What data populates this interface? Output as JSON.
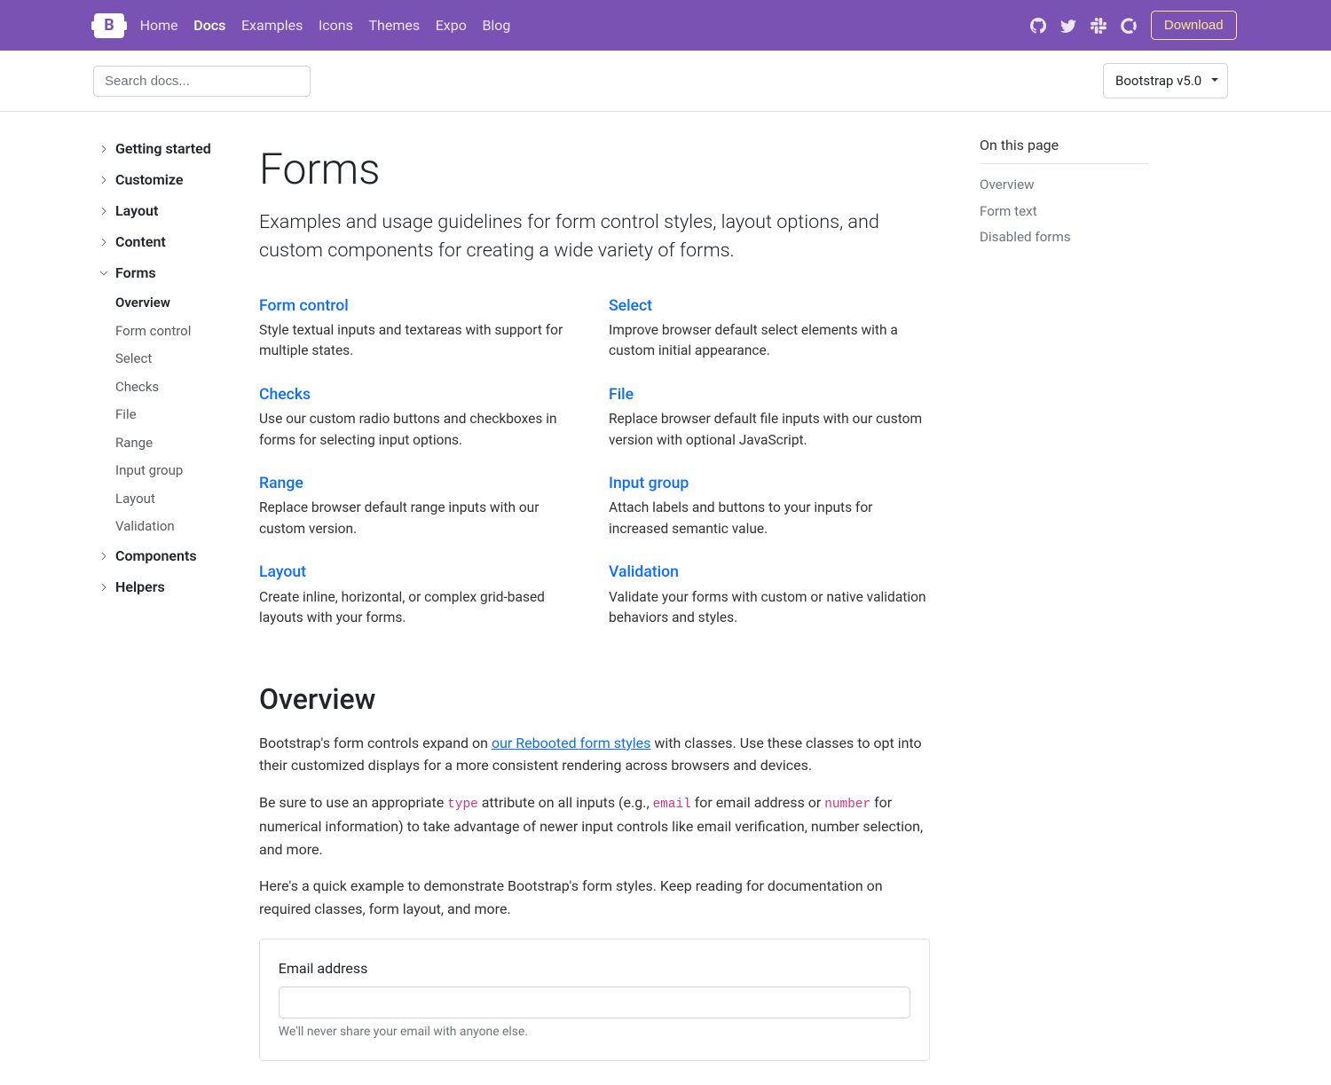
{
  "navbar": {
    "items": [
      {
        "label": "Home",
        "active": false
      },
      {
        "label": "Docs",
        "active": true
      },
      {
        "label": "Examples",
        "active": false
      },
      {
        "label": "Icons",
        "active": false
      },
      {
        "label": "Themes",
        "active": false
      },
      {
        "label": "Expo",
        "active": false
      },
      {
        "label": "Blog",
        "active": false
      }
    ],
    "download": "Download"
  },
  "subnav": {
    "search_placeholder": "Search docs...",
    "version": "Bootstrap v5.0"
  },
  "sidebar": {
    "groups": [
      {
        "label": "Getting started",
        "expanded": false
      },
      {
        "label": "Customize",
        "expanded": false
      },
      {
        "label": "Layout",
        "expanded": false
      },
      {
        "label": "Content",
        "expanded": false
      },
      {
        "label": "Forms",
        "expanded": true,
        "items": [
          {
            "label": "Overview",
            "active": true
          },
          {
            "label": "Form control",
            "active": false
          },
          {
            "label": "Select",
            "active": false
          },
          {
            "label": "Checks",
            "active": false
          },
          {
            "label": "File",
            "active": false
          },
          {
            "label": "Range",
            "active": false
          },
          {
            "label": "Input group",
            "active": false
          },
          {
            "label": "Layout",
            "active": false
          },
          {
            "label": "Validation",
            "active": false
          }
        ]
      },
      {
        "label": "Components",
        "expanded": false
      },
      {
        "label": "Helpers",
        "expanded": false
      }
    ]
  },
  "page": {
    "title": "Forms",
    "lead": "Examples and usage guidelines for form control styles, layout options, and custom components for creating a wide variety of forms.",
    "sections": [
      {
        "title": "Form control",
        "desc": "Style textual inputs and textareas with support for multiple states."
      },
      {
        "title": "Select",
        "desc": "Improve browser default select elements with a custom initial appearance."
      },
      {
        "title": "Checks",
        "desc": "Use our custom radio buttons and checkboxes in forms for selecting input options."
      },
      {
        "title": "File",
        "desc": "Replace browser default file inputs with our custom version with optional JavaScript."
      },
      {
        "title": "Range",
        "desc": "Replace browser default range inputs with our custom version."
      },
      {
        "title": "Input group",
        "desc": "Attach labels and buttons to your inputs for increased semantic value."
      },
      {
        "title": "Layout",
        "desc": "Create inline, horizontal, or complex grid-based layouts with your forms."
      },
      {
        "title": "Validation",
        "desc": "Validate your forms with custom or native validation behaviors and styles."
      }
    ],
    "overview": {
      "heading": "Overview",
      "p1_pre": "Bootstrap's form controls expand on ",
      "p1_link": "our Rebooted form styles",
      "p1_post": " with classes. Use these classes to opt into their customized displays for a more consistent rendering across browsers and devices.",
      "p2_a": "Be sure to use an appropriate ",
      "p2_code1": "type",
      "p2_b": " attribute on all inputs (e.g., ",
      "p2_code2": "email",
      "p2_c": " for email address or ",
      "p2_code3": "number",
      "p2_d": " for numerical information) to take advantage of newer input controls like email verification, number selection, and more.",
      "p3": "Here's a quick example to demonstrate Bootstrap's form styles. Keep reading for documentation on required classes, form layout, and more."
    },
    "example": {
      "email_label": "Email address",
      "email_help": "We'll never share your email with anyone else."
    }
  },
  "toc": {
    "title": "On this page",
    "items": [
      {
        "label": "Overview"
      },
      {
        "label": "Form text"
      },
      {
        "label": "Disabled forms"
      }
    ]
  }
}
